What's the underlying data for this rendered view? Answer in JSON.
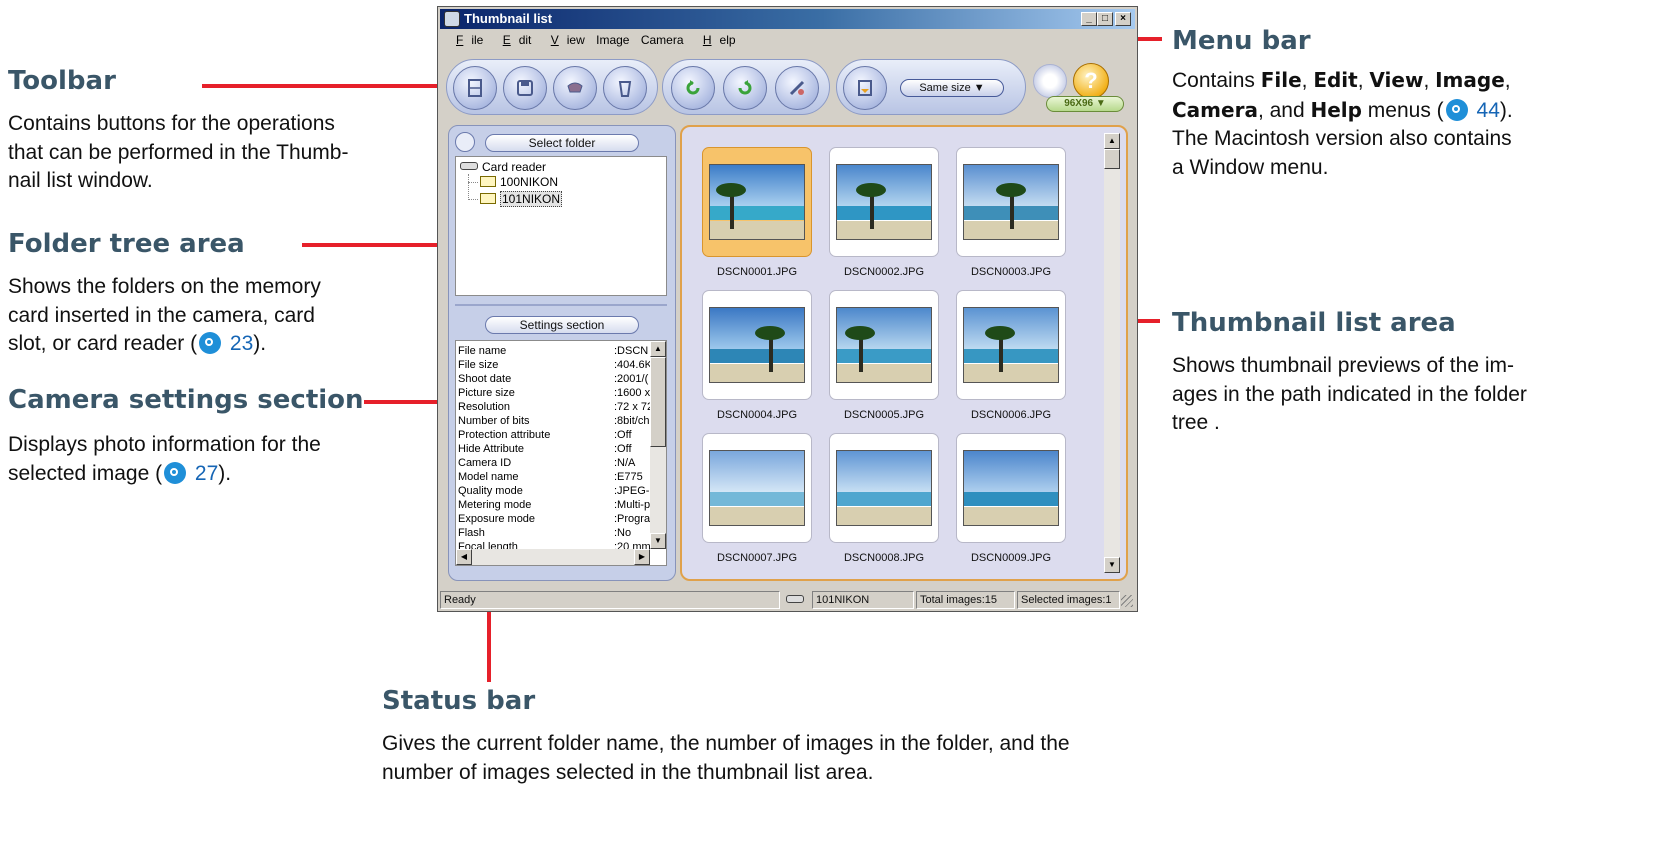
{
  "window": {
    "title": "Thumbnail list",
    "controls": [
      "_",
      "□",
      "×"
    ],
    "menu": [
      {
        "label": "File",
        "mnemonic": "F",
        "rest": "ile"
      },
      {
        "label": "Edit",
        "mnemonic": "E",
        "rest": "dit"
      },
      {
        "label": "View",
        "mnemonic": "V",
        "rest": "iew"
      },
      {
        "label": "Image",
        "mnemonic": "",
        "rest": "Image"
      },
      {
        "label": "Camera",
        "mnemonic": "",
        "rest": "Camera"
      },
      {
        "label": "Help",
        "mnemonic": "H",
        "rest": "elp"
      }
    ],
    "toolbar": {
      "buttons": [
        "film-icon",
        "save-icon",
        "camera-icon",
        "trash-icon",
        "rotate-left-icon",
        "rotate-right-icon",
        "tools-icon",
        "transfer-icon"
      ],
      "size_select": "Same size",
      "thumb_size": "96X96",
      "help_glyph": "?"
    },
    "folder_header": "Select folder",
    "tree": {
      "root": "Card reader",
      "folders": [
        "100NIKON",
        "101NIKON"
      ],
      "selected": "101NIKON"
    },
    "settings_header": "Settings section",
    "settings": [
      {
        "k": "File name",
        "v": ":DSCN"
      },
      {
        "k": "File size",
        "v": ":404.6K"
      },
      {
        "k": "Shoot date",
        "v": ":2001/("
      },
      {
        "k": "Picture size",
        "v": ":1600 x"
      },
      {
        "k": "Resolution",
        "v": ":72 x 72"
      },
      {
        "k": "Number of bits",
        "v": ":8bit/ch"
      },
      {
        "k": "Protection attribute",
        "v": ":Off"
      },
      {
        "k": "Hide Attribute",
        "v": ":Off"
      },
      {
        "k": "Camera ID",
        "v": ":N/A"
      },
      {
        "k": "Model name",
        "v": ":E775"
      },
      {
        "k": "Quality mode",
        "v": ":JPEG-"
      },
      {
        "k": "Metering mode",
        "v": ":Multi-p"
      },
      {
        "k": "Exposure mode",
        "v": ":Progra"
      },
      {
        "k": "Flash",
        "v": ":No"
      },
      {
        "k": "Focal length",
        "v": ":20 mm"
      }
    ],
    "thumbnails": [
      "DSCN0001.JPG",
      "DSCN0002.JPG",
      "DSCN0003.JPG",
      "DSCN0004.JPG",
      "DSCN0005.JPG",
      "DSCN0006.JPG",
      "DSCN0007.JPG",
      "DSCN0008.JPG",
      "DSCN0009.JPG"
    ],
    "selected_thumbnail": "DSCN0001.JPG",
    "status": {
      "text": "Ready",
      "folder": "101NIKON",
      "total": "Total images:15",
      "selected": "Selected images:1"
    }
  },
  "annotations": {
    "toolbar": {
      "title": "Toolbar",
      "body": [
        "Contains buttons for the operations",
        "that can be performed in the Thumb-",
        "nail list window."
      ]
    },
    "folder_tree": {
      "title": "Folder tree area",
      "body1": "Shows the folders on the memory",
      "body2": "card inserted in the camera, card",
      "body3a": "slot, or card reader (",
      "ref": "23",
      "body3b": ")."
    },
    "camera_settings": {
      "title": "Camera settings section",
      "body1": "Displays photo information for the",
      "body2a": "selected image (",
      "ref": "27",
      "body2b": ")."
    },
    "menu_bar": {
      "title": "Menu bar",
      "l1a": "Contains ",
      "file": "File",
      "c1": ", ",
      "edit": "Edit",
      "c2": ", ",
      "view": "View",
      "c3": ", ",
      "image": "Image",
      "c4": ",",
      "camera": "Camera",
      "c5": ", and ",
      "help": "Help",
      "l2b": " menus (",
      "ref": "44",
      "l2c": ").",
      "l3": "The Macintosh version also contains",
      "l4": "a Window menu."
    },
    "thumbnail_area": {
      "title": "Thumbnail list area",
      "body": [
        "Shows thumbnail previews of the im-",
        "ages in the path indicated in the folder",
        "tree ."
      ]
    },
    "status_bar": {
      "title": "Status bar",
      "body": [
        "Gives the current folder name, the number of images in the folder, and the",
        "number of images selected in the thumbnail list area."
      ]
    }
  },
  "colors": {
    "callout_title": "#3a5668",
    "leader_line": "#e6202a",
    "selection": "#f7c36a",
    "reference_icon": "#1f8fd8"
  }
}
